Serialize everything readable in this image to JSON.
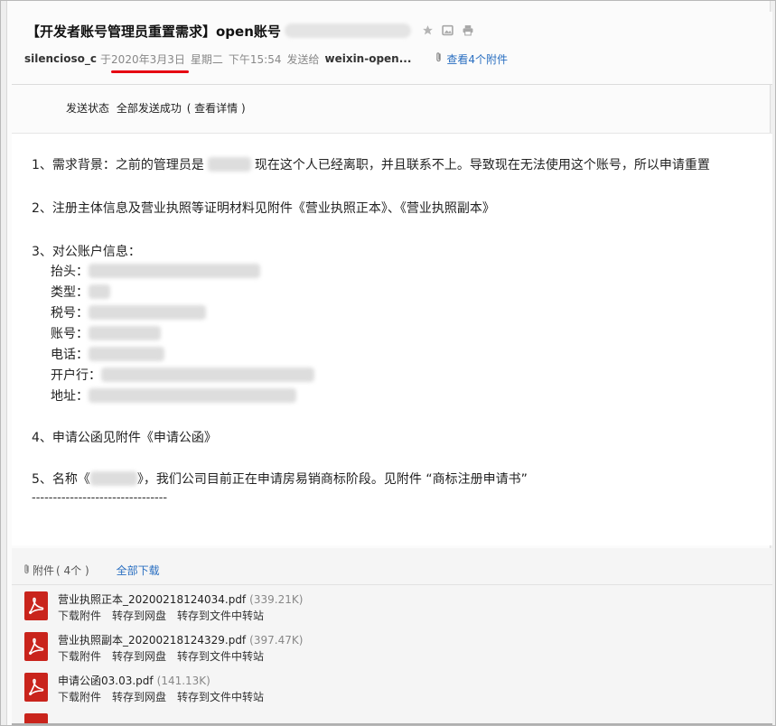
{
  "header": {
    "subject": "【开发者账号管理员重置需求】open账号",
    "sender": "silencioso_c",
    "date_prefix": "于",
    "date": "2020年3月3日",
    "weekday": "星期二",
    "time": "下午15:54",
    "sent_to_label": "发送给",
    "recipient": "weixin-open...",
    "attachments_link": "查看4个附件",
    "icons": [
      "star-icon",
      "image-icon",
      "print-icon"
    ],
    "accent_color": "#2a6fc1",
    "highlight_color": "#e60012"
  },
  "status": {
    "label": "发送状态",
    "value": "全部发送成功",
    "details": "( 查看详情 )"
  },
  "body": {
    "line1": "1、需求背景：之前的管理员是",
    "line1_after": "现在这个人已经离职，并且联系不上。导致现在无法使用这个账号，所以申请重置",
    "line2": "2、注册主体信息及营业执照等证明材料见附件《营业执照正本》、《营业执照副本》",
    "line3": "3、对公账户信息：",
    "fields": [
      {
        "label": "抬头："
      },
      {
        "label": "类型："
      },
      {
        "label": "税号："
      },
      {
        "label": "账号："
      },
      {
        "label": "电话："
      },
      {
        "label": "开户行："
      },
      {
        "label": "地址："
      }
    ],
    "line4": "4、申请公函见附件《申请公函》",
    "line5_a": "5、名称《",
    "line5_b": "》，我们公司目前正在申请房易销商标阶段。见附件 “商标注册申请书”",
    "dashes": "--------------------------------"
  },
  "attachments": {
    "label": "附件",
    "count": "( 4个 )",
    "download_all": "全部下载",
    "items": [
      {
        "name": "营业执照正本_20200218124034.pdf",
        "size": "(339.21K)"
      },
      {
        "name": "营业执照副本_20200218124329.pdf",
        "size": "(397.47K)"
      },
      {
        "name": "申请公函03.03.pdf",
        "size": "(141.13K)"
      }
    ],
    "actions": [
      "下载附件",
      "转存到网盘",
      "转存到文件中转站"
    ]
  }
}
